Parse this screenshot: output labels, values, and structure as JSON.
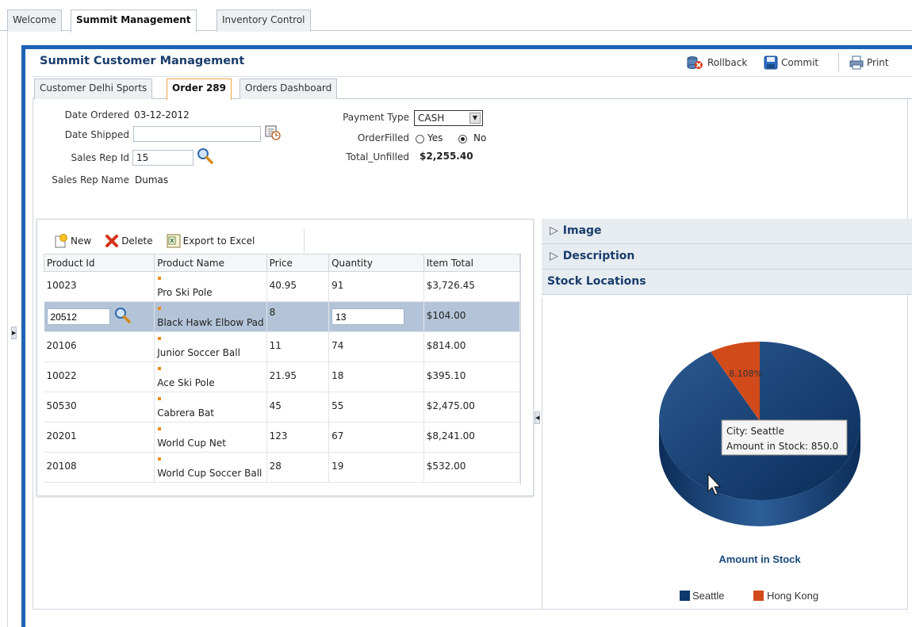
{
  "top_tabs": [
    "Welcome",
    "Summit Management",
    "Inventory Control"
  ],
  "panel": {
    "title": "Summit Customer Management",
    "toolbar": {
      "rollback": "Rollback",
      "commit": "Commit",
      "print": "Print"
    }
  },
  "sub_tabs": [
    "Customer Delhi Sports",
    "Order 289",
    "Orders Dashboard"
  ],
  "order": {
    "date_ordered_label": "Date Ordered",
    "date_ordered": "03-12-2012",
    "date_shipped_label": "Date Shipped",
    "date_shipped": "",
    "sales_rep_id_label": "Sales Rep Id",
    "sales_rep_id": "15",
    "sales_rep_name_label": "Sales Rep Name",
    "sales_rep_name": "Dumas",
    "payment_type_label": "Payment Type",
    "payment_type": "CASH",
    "order_filled_label": "OrderFilled",
    "order_filled_yes": "Yes",
    "order_filled_no": "No",
    "order_filled_selected": "No",
    "total_unfilled_label": "Total_Unfilled",
    "total_unfilled": "$2,255.40"
  },
  "table": {
    "toolbar": {
      "new": "New",
      "delete": "Delete",
      "export": "Export to Excel"
    },
    "columns": [
      "Product Id",
      "Product Name",
      "Price",
      "Quantity",
      "Item Total"
    ],
    "rows": [
      [
        "10023",
        "Pro Ski Pole",
        "40.95",
        "91",
        "$3,726.45"
      ],
      [
        "20512",
        "Black Hawk Elbow Pad",
        "8",
        "13",
        "$104.00"
      ],
      [
        "20106",
        "Junior Soccer Ball",
        "11",
        "74",
        "$814.00"
      ],
      [
        "10022",
        "Ace Ski Pole",
        "21.95",
        "18",
        "$395.10"
      ],
      [
        "50530",
        "Cabrera Bat",
        "45",
        "55",
        "$2,475.00"
      ],
      [
        "20201",
        "World Cup Net",
        "123",
        "67",
        "$8,241.00"
      ],
      [
        "20108",
        "World Cup Soccer Ball",
        "28",
        "19",
        "$532.00"
      ]
    ],
    "selected_row": 1
  },
  "right_panel": {
    "sections": [
      "Image",
      "Description",
      "Stock Locations"
    ]
  },
  "chart_data": {
    "type": "pie",
    "title": "Amount in Stock",
    "categories": [
      "Seattle",
      "Hong Kong"
    ],
    "values": [
      850.0,
      75.0
    ],
    "slice_labels": [
      "",
      "8.108%"
    ],
    "colors": [
      "#0d3a6e",
      "#d14a1a"
    ],
    "legend": "bottom",
    "tooltip": {
      "line1": "City: Seattle",
      "line2": "Amount in Stock: 850.0"
    }
  }
}
